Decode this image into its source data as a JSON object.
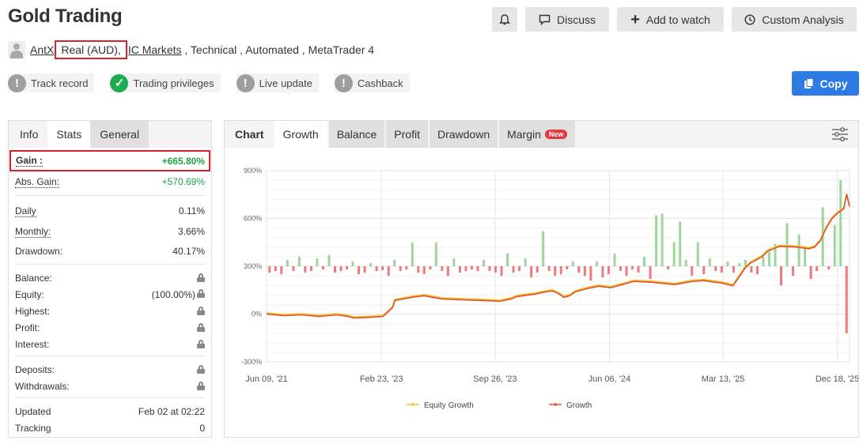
{
  "header": {
    "title": "Gold Trading",
    "discuss": "Discuss",
    "add_watch": "Add to watch",
    "custom_analysis": "Custom Analysis",
    "copy": "Copy"
  },
  "meta": {
    "user": "AntX",
    "account": "Real (AUD),",
    "broker": "IC Markets",
    "tags": " , Technical , Automated , MetaTrader 4"
  },
  "badges": [
    {
      "label": "Track record",
      "ok": false
    },
    {
      "label": "Trading privileges",
      "ok": true
    },
    {
      "label": "Live update",
      "ok": false
    },
    {
      "label": "Cashback",
      "ok": false
    }
  ],
  "left": {
    "tabs": [
      "Info",
      "Stats",
      "General"
    ],
    "gain_label": "Gain :",
    "gain": "+665.80%",
    "abs_gain_label": "Abs. Gain:",
    "abs_gain": "+570.69%",
    "daily_label": "Daily",
    "daily": "0.11%",
    "monthly_label": "Monthly:",
    "monthly": "3.66%",
    "drawdown_label": "Drawdown:",
    "drawdown": "40.17%",
    "balance_label": "Balance:",
    "equity_label": "Equity:",
    "equity": "(100.00%)",
    "highest_label": "Highest:",
    "profit_label": "Profit:",
    "interest_label": "Interest:",
    "deposits_label": "Deposits:",
    "withdrawals_label": "Withdrawals:",
    "updated_label": "Updated",
    "updated": "Feb 02 at 02:22",
    "tracking_label": "Tracking",
    "tracking": "0"
  },
  "right": {
    "tabs": [
      "Chart",
      "Growth",
      "Balance",
      "Profit",
      "Drawdown",
      "Margin"
    ],
    "new_badge": "New"
  },
  "chart_data": {
    "type": "line",
    "yticks": [
      "900%",
      "600%",
      "300%",
      "0%",
      "-300%"
    ],
    "ylim": [
      -300,
      900
    ],
    "xlim": [
      0,
      100
    ],
    "xticks": [
      {
        "x": 0,
        "label": "Jun 09, '21"
      },
      {
        "x": 19.7,
        "label": "Feb 23, '23"
      },
      {
        "x": 39.2,
        "label": "Sep 26, '23"
      },
      {
        "x": 58.8,
        "label": "Jun 06, '24"
      },
      {
        "x": 78.3,
        "label": "Mar 13, '25"
      },
      {
        "x": 97.9,
        "label": "Dec 18, '25"
      }
    ],
    "legend": [
      "Equity Growth",
      "Growth"
    ],
    "colors": {
      "equity": "#f2c230",
      "growth": "#e0502d",
      "up": "#9ed59a",
      "down": "#ee7b7b",
      "grid": "#e6e6e6"
    },
    "growth": [
      [
        0,
        0
      ],
      [
        3,
        -10
      ],
      [
        6,
        -5
      ],
      [
        9,
        -15
      ],
      [
        12,
        -5
      ],
      [
        14,
        -15
      ],
      [
        15,
        -25
      ],
      [
        18,
        -20
      ],
      [
        20,
        -15
      ],
      [
        21.6,
        40
      ],
      [
        22,
        85
      ],
      [
        25,
        105
      ],
      [
        27,
        115
      ],
      [
        30,
        95
      ],
      [
        33,
        90
      ],
      [
        37,
        85
      ],
      [
        40,
        80
      ],
      [
        42,
        95
      ],
      [
        43,
        110
      ],
      [
        46,
        125
      ],
      [
        48,
        140
      ],
      [
        49,
        145
      ],
      [
        50,
        130
      ],
      [
        51,
        105
      ],
      [
        52,
        115
      ],
      [
        53,
        140
      ],
      [
        55,
        160
      ],
      [
        57,
        175
      ],
      [
        59,
        165
      ],
      [
        61,
        185
      ],
      [
        63,
        205
      ],
      [
        66,
        200
      ],
      [
        70,
        185
      ],
      [
        73,
        205
      ],
      [
        75,
        210
      ],
      [
        78,
        195
      ],
      [
        80,
        178
      ],
      [
        81,
        230
      ],
      [
        82,
        285
      ],
      [
        83,
        320
      ],
      [
        84,
        340
      ],
      [
        85,
        360
      ],
      [
        86,
        395
      ],
      [
        87,
        410
      ],
      [
        88,
        425
      ],
      [
        91,
        420
      ],
      [
        93,
        410
      ],
      [
        94,
        420
      ],
      [
        95,
        460
      ],
      [
        96,
        540
      ],
      [
        97,
        600
      ],
      [
        98,
        635
      ],
      [
        99,
        660
      ],
      [
        99.5,
        750
      ],
      [
        100,
        675
      ]
    ],
    "bar_baseline": 300,
    "bars": [
      -40,
      -30,
      -50,
      40,
      -30,
      60,
      -40,
      -30,
      50,
      -20,
      70,
      -40,
      -30,
      -20,
      30,
      -50,
      -40,
      20,
      -30,
      -25,
      -60,
      40,
      -30,
      -20,
      150,
      -40,
      -50,
      -20,
      150,
      -30,
      -60,
      50,
      -40,
      -30,
      -20,
      -30,
      40,
      -30,
      -40,
      -60,
      80,
      -40,
      -30,
      50,
      -70,
      -40,
      220,
      -30,
      -60,
      -50,
      -20,
      30,
      -40,
      -60,
      -90,
      30,
      -70,
      -50,
      80,
      -30,
      -60,
      -20,
      -40,
      60,
      -80,
      320,
      330,
      -20,
      150,
      280,
      40,
      -60,
      150,
      -50,
      50,
      -30,
      -40,
      30,
      -40,
      20,
      40,
      -40,
      -50,
      60,
      90,
      140,
      -120,
      270,
      -60,
      200,
      110,
      -80,
      -30,
      370,
      -20,
      260,
      540,
      -420
    ]
  }
}
